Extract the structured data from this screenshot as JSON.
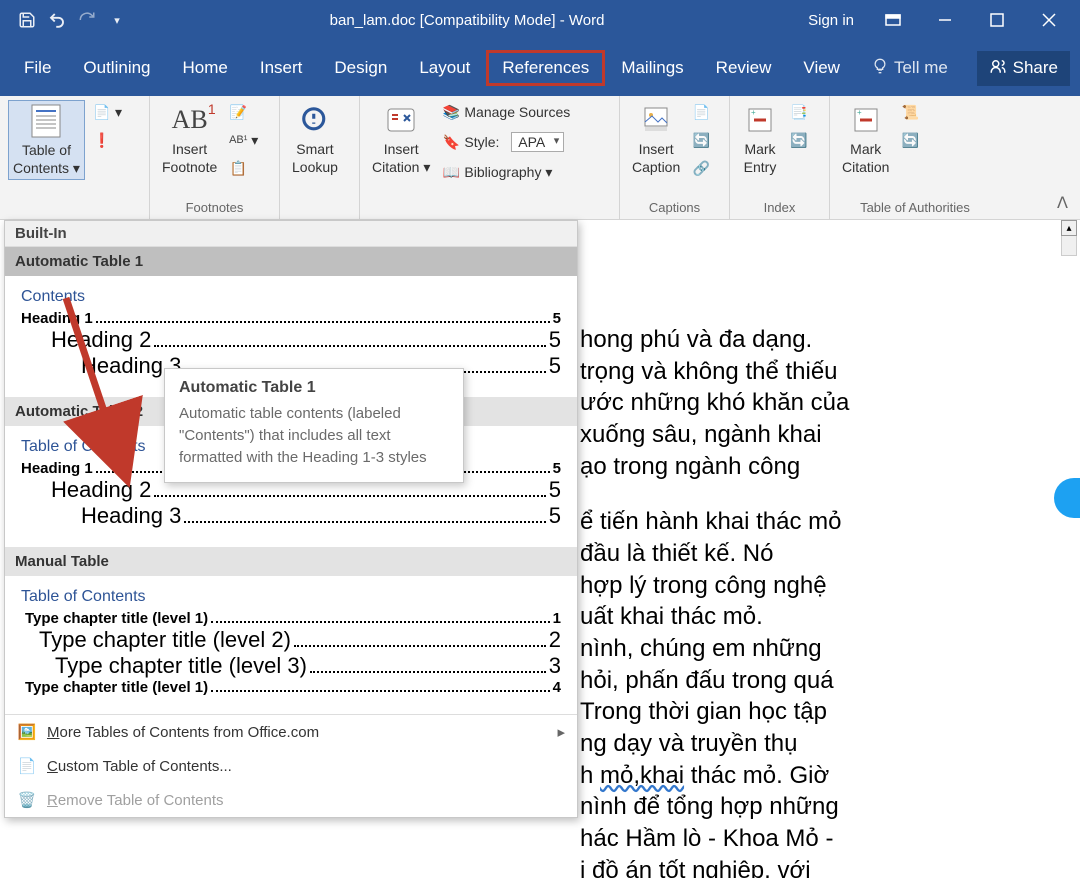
{
  "titlebar": {
    "title": "ban_lam.doc [Compatibility Mode]  -  Word",
    "signin": "Sign in"
  },
  "tabs": {
    "file": "File",
    "outlining": "Outlining",
    "home": "Home",
    "insert": "Insert",
    "design": "Design",
    "layout": "Layout",
    "references": "References",
    "mailings": "Mailings",
    "review": "Review",
    "view": "View",
    "tellme": "Tell me"
  },
  "share": "Share",
  "ribbon": {
    "toc": {
      "btn": "Table of\nContents ▾"
    },
    "footnotes": {
      "insert_footnote": "Insert\nFootnote",
      "group": "Footnotes"
    },
    "research": {
      "smart_lookup": "Smart\nLookup"
    },
    "citations": {
      "insert_citation": "Insert\nCitation ▾",
      "manage": "Manage Sources",
      "style_label": "Style:",
      "style_value": "APA",
      "biblio": "Bibliography ▾"
    },
    "captions": {
      "insert_caption": "Insert\nCaption",
      "group": "Captions"
    },
    "index": {
      "mark_entry": "Mark\nEntry",
      "group": "Index"
    },
    "toa": {
      "mark_citation": "Mark\nCitation",
      "group": "Table of Authorities"
    }
  },
  "dropdown": {
    "builtin": "Built-In",
    "auto1": {
      "title": "Automatic Table 1",
      "toc_title": "Contents",
      "h1": "Heading 1",
      "h1p": "5",
      "h2": "Heading 2",
      "h2p": "5",
      "h3": "Heading 3",
      "h3p": "5"
    },
    "auto2": {
      "title": "Automatic Table 2",
      "toc_title": "Table of Contents",
      "h1": "Heading 1",
      "h1p": "5",
      "h2": "Heading 2",
      "h2p": "5",
      "h3": "Heading 3",
      "h3p": "5"
    },
    "manual": {
      "title": "Manual Table",
      "toc_title": "Table of Contents",
      "l1a": "Type chapter title (level 1)",
      "l1ap": "1",
      "l2": "Type chapter title (level 2)",
      "l2p": "2",
      "l3": "Type chapter title (level 3)",
      "l3p": "3",
      "l1b": "Type chapter title (level 1)",
      "l1bp": "4"
    },
    "footer": {
      "more_pre": "M",
      "more": "ore Tables of Contents from Office.com",
      "custom_pre": "C",
      "custom": "ustom Table of Contents...",
      "remove_pre": "R",
      "remove": "emove Table of Contents"
    }
  },
  "tooltip": {
    "title": "Automatic Table 1",
    "body": "Automatic table contents (labeled \"Contents\") that includes all text formatted with the Heading 1-3 styles"
  },
  "doc": {
    "l1": "hong phú và đa dạng.",
    "l2": "trọng và không thể thiếu",
    "l3": "ước những khó khăn của",
    "l4": "xuống sâu, ngành khai",
    "l5": "ạo trong ngành công",
    "l6": "ể tiến hành khai thác mỏ",
    "l7": " đầu là thiết kế.  Nó",
    "l8": " hợp lý trong công nghệ",
    "l9": "uất khai thác mỏ.",
    "l10": "nình, chúng em những",
    "l11": "hỏi, phấn đấu trong quá",
    "l12": " Trong thời gian học tập",
    "l13": "ng dạy và truyền thụ",
    "l14a": "h ",
    "l14b": "mỏ,khai",
    "l14c": " thác mỏ. Giờ",
    "l15": "nình để tổng hợp những",
    "l16": "hác Hầm lò - Khoa Mỏ -",
    "l17": "i đồ án tốt nghiệp, với"
  }
}
